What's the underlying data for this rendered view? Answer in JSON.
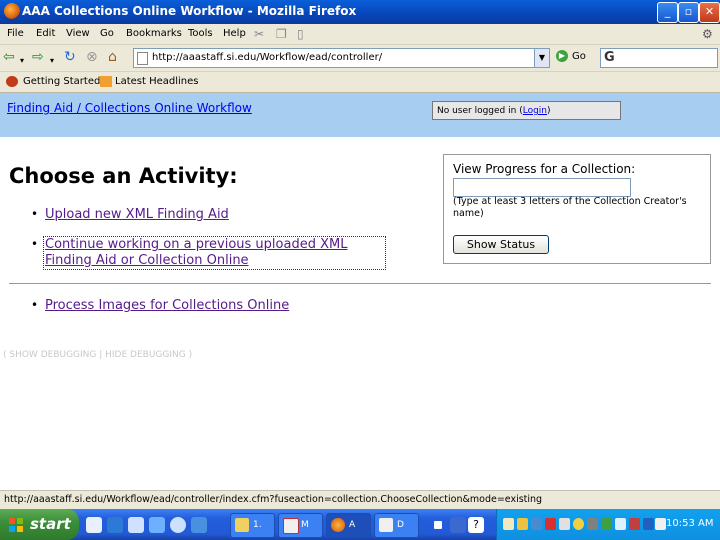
{
  "window": {
    "title": "AAA Collections Online Workflow - Mozilla Firefox"
  },
  "menu": [
    "File",
    "Edit",
    "View",
    "Go",
    "Bookmarks",
    "Tools",
    "Help"
  ],
  "navigation": {
    "url": "http://aaastaff.si.edu/Workflow/ead/controller/",
    "go_label": "Go",
    "search_logo": "G"
  },
  "bookmarks": [
    "Getting Started",
    "Latest Headlines"
  ],
  "page": {
    "breadcrumb": "Finding Aid / Collections Online Workflow",
    "login": {
      "prefix": "No user logged in (",
      "link": "Login",
      "suffix": ")"
    },
    "heading": "Choose an Activity:",
    "activities": [
      "Upload new XML Finding Aid",
      "Continue working on a previous uploaded XML",
      "Finding Aid or Collection Online",
      "Process Images for Collections Online"
    ],
    "debug_links": "( SHOW DEBUGGING | HIDE DEBUGGING )"
  },
  "status_panel": {
    "title": "View Progress for a Collection:",
    "input_value": "",
    "hint": "(Type at least 3 letters of the Collection Creator's name)",
    "button_label": "Show Status"
  },
  "statusbar": {
    "text": "http://aaastaff.si.edu/Workflow/ead/controller/index.cfm?fuseaction=collection.ChooseCollection&mode=existing"
  },
  "taskbar": {
    "start_label": "start",
    "tasks": [
      "1.",
      "M",
      "A",
      "D"
    ],
    "clock": "10:53 AM"
  }
}
